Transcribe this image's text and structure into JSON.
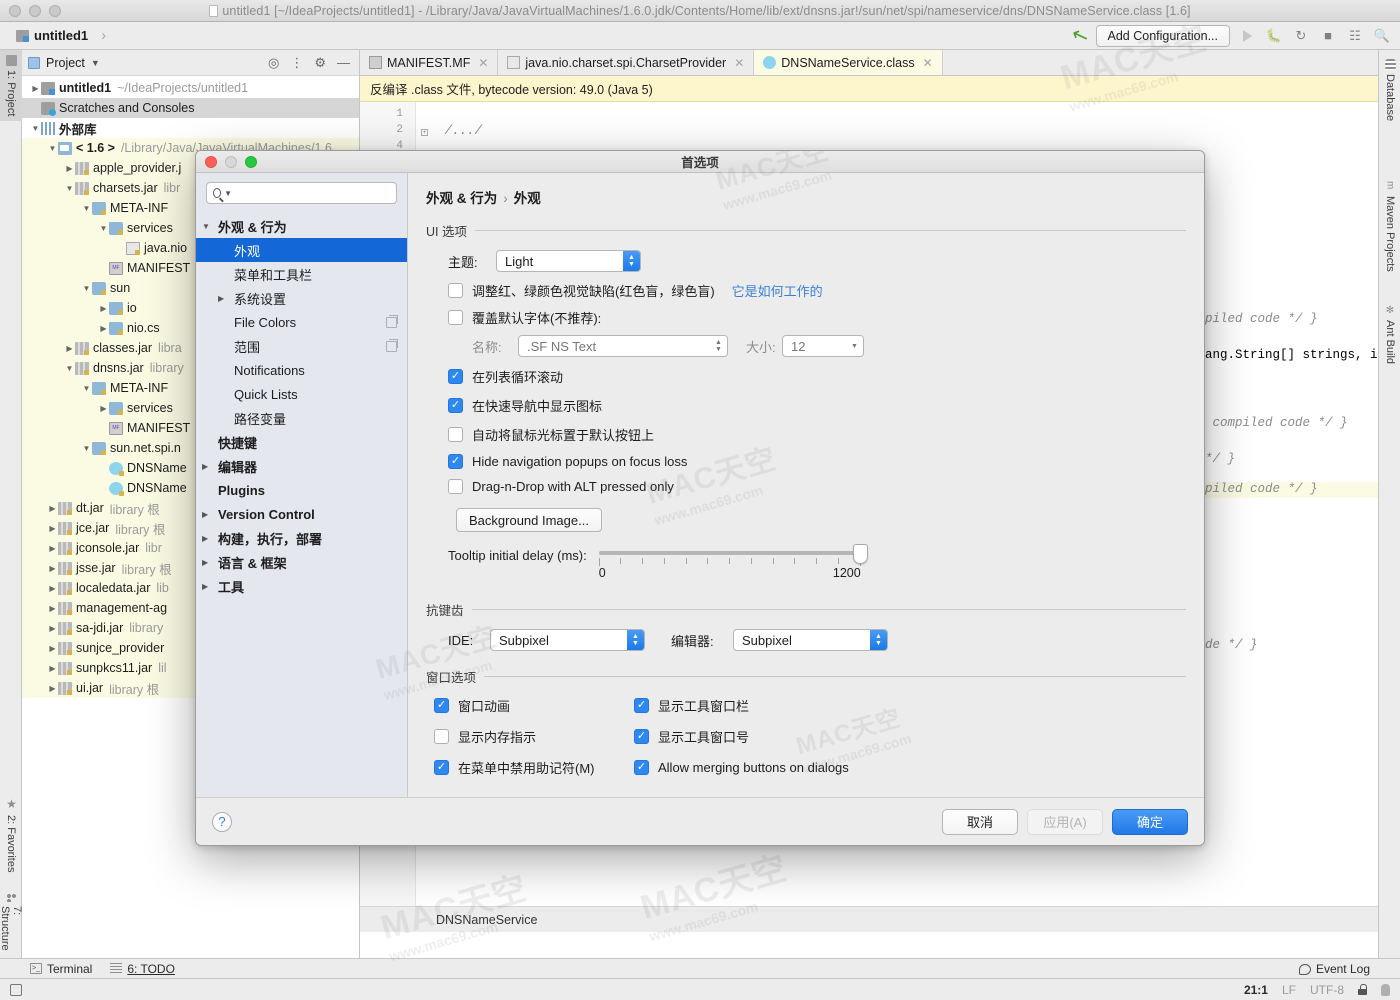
{
  "window": {
    "title": "untitled1 [~/IdeaProjects/untitled1] - /Library/Java/JavaVirtualMachines/1.6.0.jdk/Contents/Home/lib/ext/dnsns.jar!/sun/net/spi/nameservice/dns/DNSNameService.class [1.6]"
  },
  "navbar": {
    "project_name": "untitled1",
    "separator": "›",
    "add_configuration": "Add Configuration..."
  },
  "left_rail": [
    {
      "label": "1: Project",
      "icon": "project-icon",
      "selected": true
    },
    {
      "label": "2: Favorites",
      "icon": "star-icon",
      "selected": false
    },
    {
      "label": "7: Structure",
      "icon": "structure-icon",
      "selected": false
    }
  ],
  "right_rail": [
    {
      "label": "Database",
      "icon": "database-icon"
    },
    {
      "label": "Maven Projects",
      "icon": "maven-icon"
    },
    {
      "label": "Ant Build",
      "icon": "ant-icon"
    }
  ],
  "project_panel": {
    "title": "Project",
    "tools": [
      {
        "name": "locate-icon",
        "glyph": "⊙"
      },
      {
        "name": "collapse-all-icon",
        "glyph": "⌶"
      },
      {
        "name": "settings-gear-icon",
        "glyph": "⚙"
      },
      {
        "name": "hide-icon",
        "glyph": "−"
      }
    ],
    "tree": [
      {
        "indent": 0,
        "toggle": "closed",
        "icon": "ic-module",
        "name": "untitled1",
        "bold": true,
        "hint": "~/IdeaProjects/untitled1",
        "lib": false,
        "sel": false
      },
      {
        "indent": 0,
        "toggle": "none",
        "icon": "ic-scratch",
        "name": "Scratches and Consoles",
        "bold": false,
        "hint": "",
        "lib": false,
        "sel": true
      },
      {
        "indent": 0,
        "toggle": "open",
        "icon": "ic-extlib",
        "name": "外部库",
        "bold": true,
        "hint": "",
        "lib": false,
        "sel": false
      },
      {
        "indent": 1,
        "toggle": "open",
        "icon": "ic-jdk",
        "name": "< 1.6 >",
        "bold": true,
        "hint": "/Library/Java/JavaVirtualMachines/1.6.",
        "lib": true,
        "sel": false
      },
      {
        "indent": 2,
        "toggle": "closed",
        "icon": "ic-jar",
        "name": "apple_provider.j",
        "bold": false,
        "hint": "",
        "lib": true,
        "sel": false
      },
      {
        "indent": 2,
        "toggle": "open",
        "icon": "ic-jar",
        "name": "charsets.jar",
        "bold": false,
        "hint": "libr",
        "lib": true,
        "sel": false
      },
      {
        "indent": 3,
        "toggle": "open",
        "icon": "ic-folder",
        "name": "META-INF",
        "bold": false,
        "hint": "",
        "lib": true,
        "sel": false
      },
      {
        "indent": 4,
        "toggle": "open",
        "icon": "ic-folder",
        "name": "services",
        "bold": false,
        "hint": "",
        "lib": true,
        "sel": false
      },
      {
        "indent": 5,
        "toggle": "none",
        "icon": "ic-file",
        "name": "java.nio",
        "bold": false,
        "hint": "",
        "lib": true,
        "sel": false
      },
      {
        "indent": 4,
        "toggle": "none",
        "icon": "ic-mf",
        "name": "MANIFEST",
        "bold": false,
        "hint": "",
        "lib": true,
        "sel": false
      },
      {
        "indent": 3,
        "toggle": "open",
        "icon": "ic-folder",
        "name": "sun",
        "bold": false,
        "hint": "",
        "lib": true,
        "sel": false
      },
      {
        "indent": 4,
        "toggle": "closed",
        "icon": "ic-folder",
        "name": "io",
        "bold": false,
        "hint": "",
        "lib": true,
        "sel": false
      },
      {
        "indent": 4,
        "toggle": "closed",
        "icon": "ic-folder",
        "name": "nio.cs",
        "bold": false,
        "hint": "",
        "lib": true,
        "sel": false
      },
      {
        "indent": 2,
        "toggle": "closed",
        "icon": "ic-jar",
        "name": "classes.jar",
        "bold": false,
        "hint": "libra",
        "lib": true,
        "sel": false
      },
      {
        "indent": 2,
        "toggle": "open",
        "icon": "ic-jar",
        "name": "dnsns.jar",
        "bold": false,
        "hint": "library",
        "lib": true,
        "sel": false
      },
      {
        "indent": 3,
        "toggle": "open",
        "icon": "ic-folder",
        "name": "META-INF",
        "bold": false,
        "hint": "",
        "lib": true,
        "sel": false
      },
      {
        "indent": 4,
        "toggle": "closed",
        "icon": "ic-folder",
        "name": "services",
        "bold": false,
        "hint": "",
        "lib": true,
        "sel": false
      },
      {
        "indent": 4,
        "toggle": "none",
        "icon": "ic-mf",
        "name": "MANIFEST",
        "bold": false,
        "hint": "",
        "lib": true,
        "sel": false
      },
      {
        "indent": 3,
        "toggle": "open",
        "icon": "ic-folder",
        "name": "sun.net.spi.n",
        "bold": false,
        "hint": "",
        "lib": true,
        "sel": false
      },
      {
        "indent": 4,
        "toggle": "none",
        "icon": "ic-class",
        "name": "DNSName",
        "bold": false,
        "hint": "",
        "lib": true,
        "sel": false
      },
      {
        "indent": 4,
        "toggle": "none",
        "icon": "ic-class",
        "name": "DNSName",
        "bold": false,
        "hint": "",
        "lib": true,
        "sel": false
      },
      {
        "indent": 1,
        "toggle": "closed",
        "icon": "ic-jar",
        "name": "dt.jar",
        "bold": false,
        "hint": "library 根",
        "lib": true,
        "sel": false
      },
      {
        "indent": 1,
        "toggle": "closed",
        "icon": "ic-jar",
        "name": "jce.jar",
        "bold": false,
        "hint": "library 根",
        "lib": true,
        "sel": false
      },
      {
        "indent": 1,
        "toggle": "closed",
        "icon": "ic-jar",
        "name": "jconsole.jar",
        "bold": false,
        "hint": "libr",
        "lib": true,
        "sel": false
      },
      {
        "indent": 1,
        "toggle": "closed",
        "icon": "ic-jar",
        "name": "jsse.jar",
        "bold": false,
        "hint": "library 根",
        "lib": true,
        "sel": false
      },
      {
        "indent": 1,
        "toggle": "closed",
        "icon": "ic-jar",
        "name": "localedata.jar",
        "bold": false,
        "hint": "lib",
        "lib": true,
        "sel": false
      },
      {
        "indent": 1,
        "toggle": "closed",
        "icon": "ic-jar",
        "name": "management-ag",
        "bold": false,
        "hint": "",
        "lib": true,
        "sel": false
      },
      {
        "indent": 1,
        "toggle": "closed",
        "icon": "ic-jar",
        "name": "sa-jdi.jar",
        "bold": false,
        "hint": "library",
        "lib": true,
        "sel": false
      },
      {
        "indent": 1,
        "toggle": "closed",
        "icon": "ic-jar",
        "name": "sunjce_provider",
        "bold": false,
        "hint": "",
        "lib": true,
        "sel": false
      },
      {
        "indent": 1,
        "toggle": "closed",
        "icon": "ic-jar",
        "name": "sunpkcs11.jar",
        "bold": false,
        "hint": "lil",
        "lib": true,
        "sel": false
      },
      {
        "indent": 1,
        "toggle": "closed",
        "icon": "ic-jar",
        "name": "ui.jar",
        "bold": false,
        "hint": "library 根",
        "lib": true,
        "sel": false
      }
    ]
  },
  "editor": {
    "tabs": [
      {
        "label": "MANIFEST.MF",
        "icon": "manifest-icon",
        "active": false
      },
      {
        "label": "java.nio.charset.spi.CharsetProvider",
        "icon": "service-file-icon",
        "active": false
      },
      {
        "label": "DNSNameService.class",
        "icon": "class-icon",
        "active": true
      }
    ],
    "notification": "反编译 .class 文件, bytecode version: 49.0 (Java 5)",
    "line_numbers": [
      "1",
      "2",
      "4"
    ],
    "code_lines": [
      {
        "text": "",
        "comment": ""
      },
      {
        "text": "/.../",
        "comment": ""
      }
    ],
    "visible_code_fragments": [
      "ompiled code */ }",
      ".lang.String[] strings, i",
      "/* compiled code */ }",
      "e */ }",
      "ompiled code */ }",
      "code */ }"
    ],
    "breadcrumb": "DNSNameService"
  },
  "bottom_strip": [
    {
      "label": "Terminal",
      "icon": "terminal-icon"
    },
    {
      "label": "6: TODO",
      "icon": "todo-icon"
    }
  ],
  "status_bar": {
    "event_log": "Event Log",
    "position": "21:1",
    "line_separator": "LF",
    "encoding": "UTF-8",
    "lock": "lock-icon"
  },
  "dialog": {
    "title": "首选项",
    "search_placeholder": "",
    "settings_tree": [
      {
        "toggle": "open",
        "label": "外观 & 行为",
        "bold": true,
        "indent": 0,
        "selected": false,
        "copy": false
      },
      {
        "toggle": "none",
        "label": "外观",
        "bold": false,
        "indent": 1,
        "selected": true,
        "copy": false
      },
      {
        "toggle": "none",
        "label": "菜单和工具栏",
        "bold": false,
        "indent": 1,
        "selected": false,
        "copy": false
      },
      {
        "toggle": "closed",
        "label": "系统设置",
        "bold": false,
        "indent": 1,
        "selected": false,
        "copy": false
      },
      {
        "toggle": "none",
        "label": "File Colors",
        "bold": false,
        "indent": 1,
        "selected": false,
        "copy": true
      },
      {
        "toggle": "none",
        "label": "范围",
        "bold": false,
        "indent": 1,
        "selected": false,
        "copy": true
      },
      {
        "toggle": "none",
        "label": "Notifications",
        "bold": false,
        "indent": 1,
        "selected": false,
        "copy": false
      },
      {
        "toggle": "none",
        "label": "Quick Lists",
        "bold": false,
        "indent": 1,
        "selected": false,
        "copy": false
      },
      {
        "toggle": "none",
        "label": "路径变量",
        "bold": false,
        "indent": 1,
        "selected": false,
        "copy": false
      },
      {
        "toggle": "none",
        "label": "快捷键",
        "bold": true,
        "indent": 0,
        "selected": false,
        "copy": false
      },
      {
        "toggle": "closed",
        "label": "编辑器",
        "bold": true,
        "indent": 0,
        "selected": false,
        "copy": false
      },
      {
        "toggle": "none",
        "label": "Plugins",
        "bold": true,
        "indent": 0,
        "selected": false,
        "copy": false
      },
      {
        "toggle": "closed",
        "label": "Version Control",
        "bold": true,
        "indent": 0,
        "selected": false,
        "copy": false
      },
      {
        "toggle": "closed",
        "label": "构建，执行，部署",
        "bold": true,
        "indent": 0,
        "selected": false,
        "copy": false
      },
      {
        "toggle": "closed",
        "label": "语言 & 框架",
        "bold": true,
        "indent": 0,
        "selected": false,
        "copy": false
      },
      {
        "toggle": "closed",
        "label": "工具",
        "bold": true,
        "indent": 0,
        "selected": false,
        "copy": false
      }
    ],
    "breadcrumb": {
      "parent": "外观 & 行为",
      "sep": "›",
      "current": "外观"
    },
    "ui_options": {
      "section_label": "UI 选项",
      "theme_label": "主题:",
      "theme_value": "Light",
      "colorblind_label": "调整红、绿颜色视觉缺陷(红色盲，绿色盲)",
      "colorblind_link": "它是如何工作的",
      "colorblind_checked": false,
      "override_font_label": "覆盖默认字体(不推荐):",
      "override_font_checked": false,
      "font_name_label": "名称:",
      "font_name_value": ".SF NS Text",
      "font_size_label": "大小:",
      "font_size_value": "12",
      "checkboxes": [
        {
          "label": "在列表循环滚动",
          "checked": true
        },
        {
          "label": "在快速导航中显示图标",
          "checked": true
        },
        {
          "label": "自动将鼠标光标置于默认按钮上",
          "checked": false
        },
        {
          "label": "Hide navigation popups on focus loss",
          "checked": true
        },
        {
          "label": "Drag-n-Drop with ALT pressed only",
          "checked": false
        }
      ],
      "background_image_button": "Background Image...",
      "tooltip_delay_label": "Tooltip initial delay (ms):",
      "tooltip_min": "0",
      "tooltip_max": "1200"
    },
    "antialiasing": {
      "section_label": "抗键齿",
      "ide_label": "IDE:",
      "ide_value": "Subpixel",
      "editor_label": "编辑器:",
      "editor_value": "Subpixel"
    },
    "window_options": {
      "section_label": "窗口选项",
      "left": [
        {
          "label": "窗口动画",
          "checked": true
        },
        {
          "label": "显示内存指示",
          "checked": false
        },
        {
          "label": "在菜单中禁用助记符(M)",
          "checked": true
        }
      ],
      "right": [
        {
          "label": "显示工具窗口栏",
          "checked": true
        },
        {
          "label": "显示工具窗口号",
          "checked": true
        },
        {
          "label": "Allow merging buttons on dialogs",
          "checked": true
        }
      ]
    },
    "footer": {
      "help": "?",
      "cancel": "取消",
      "apply": "应用(A)",
      "ok": "确定"
    }
  },
  "watermarks": [
    "MAC天空",
    "www.mac69.com"
  ],
  "colors": {
    "accent": "#1467d6",
    "primary_button": "#2179e8",
    "checkbox": "#2f87f0",
    "notification_bg": "#fdf6cd",
    "library_bg": "#fbfbe4"
  }
}
